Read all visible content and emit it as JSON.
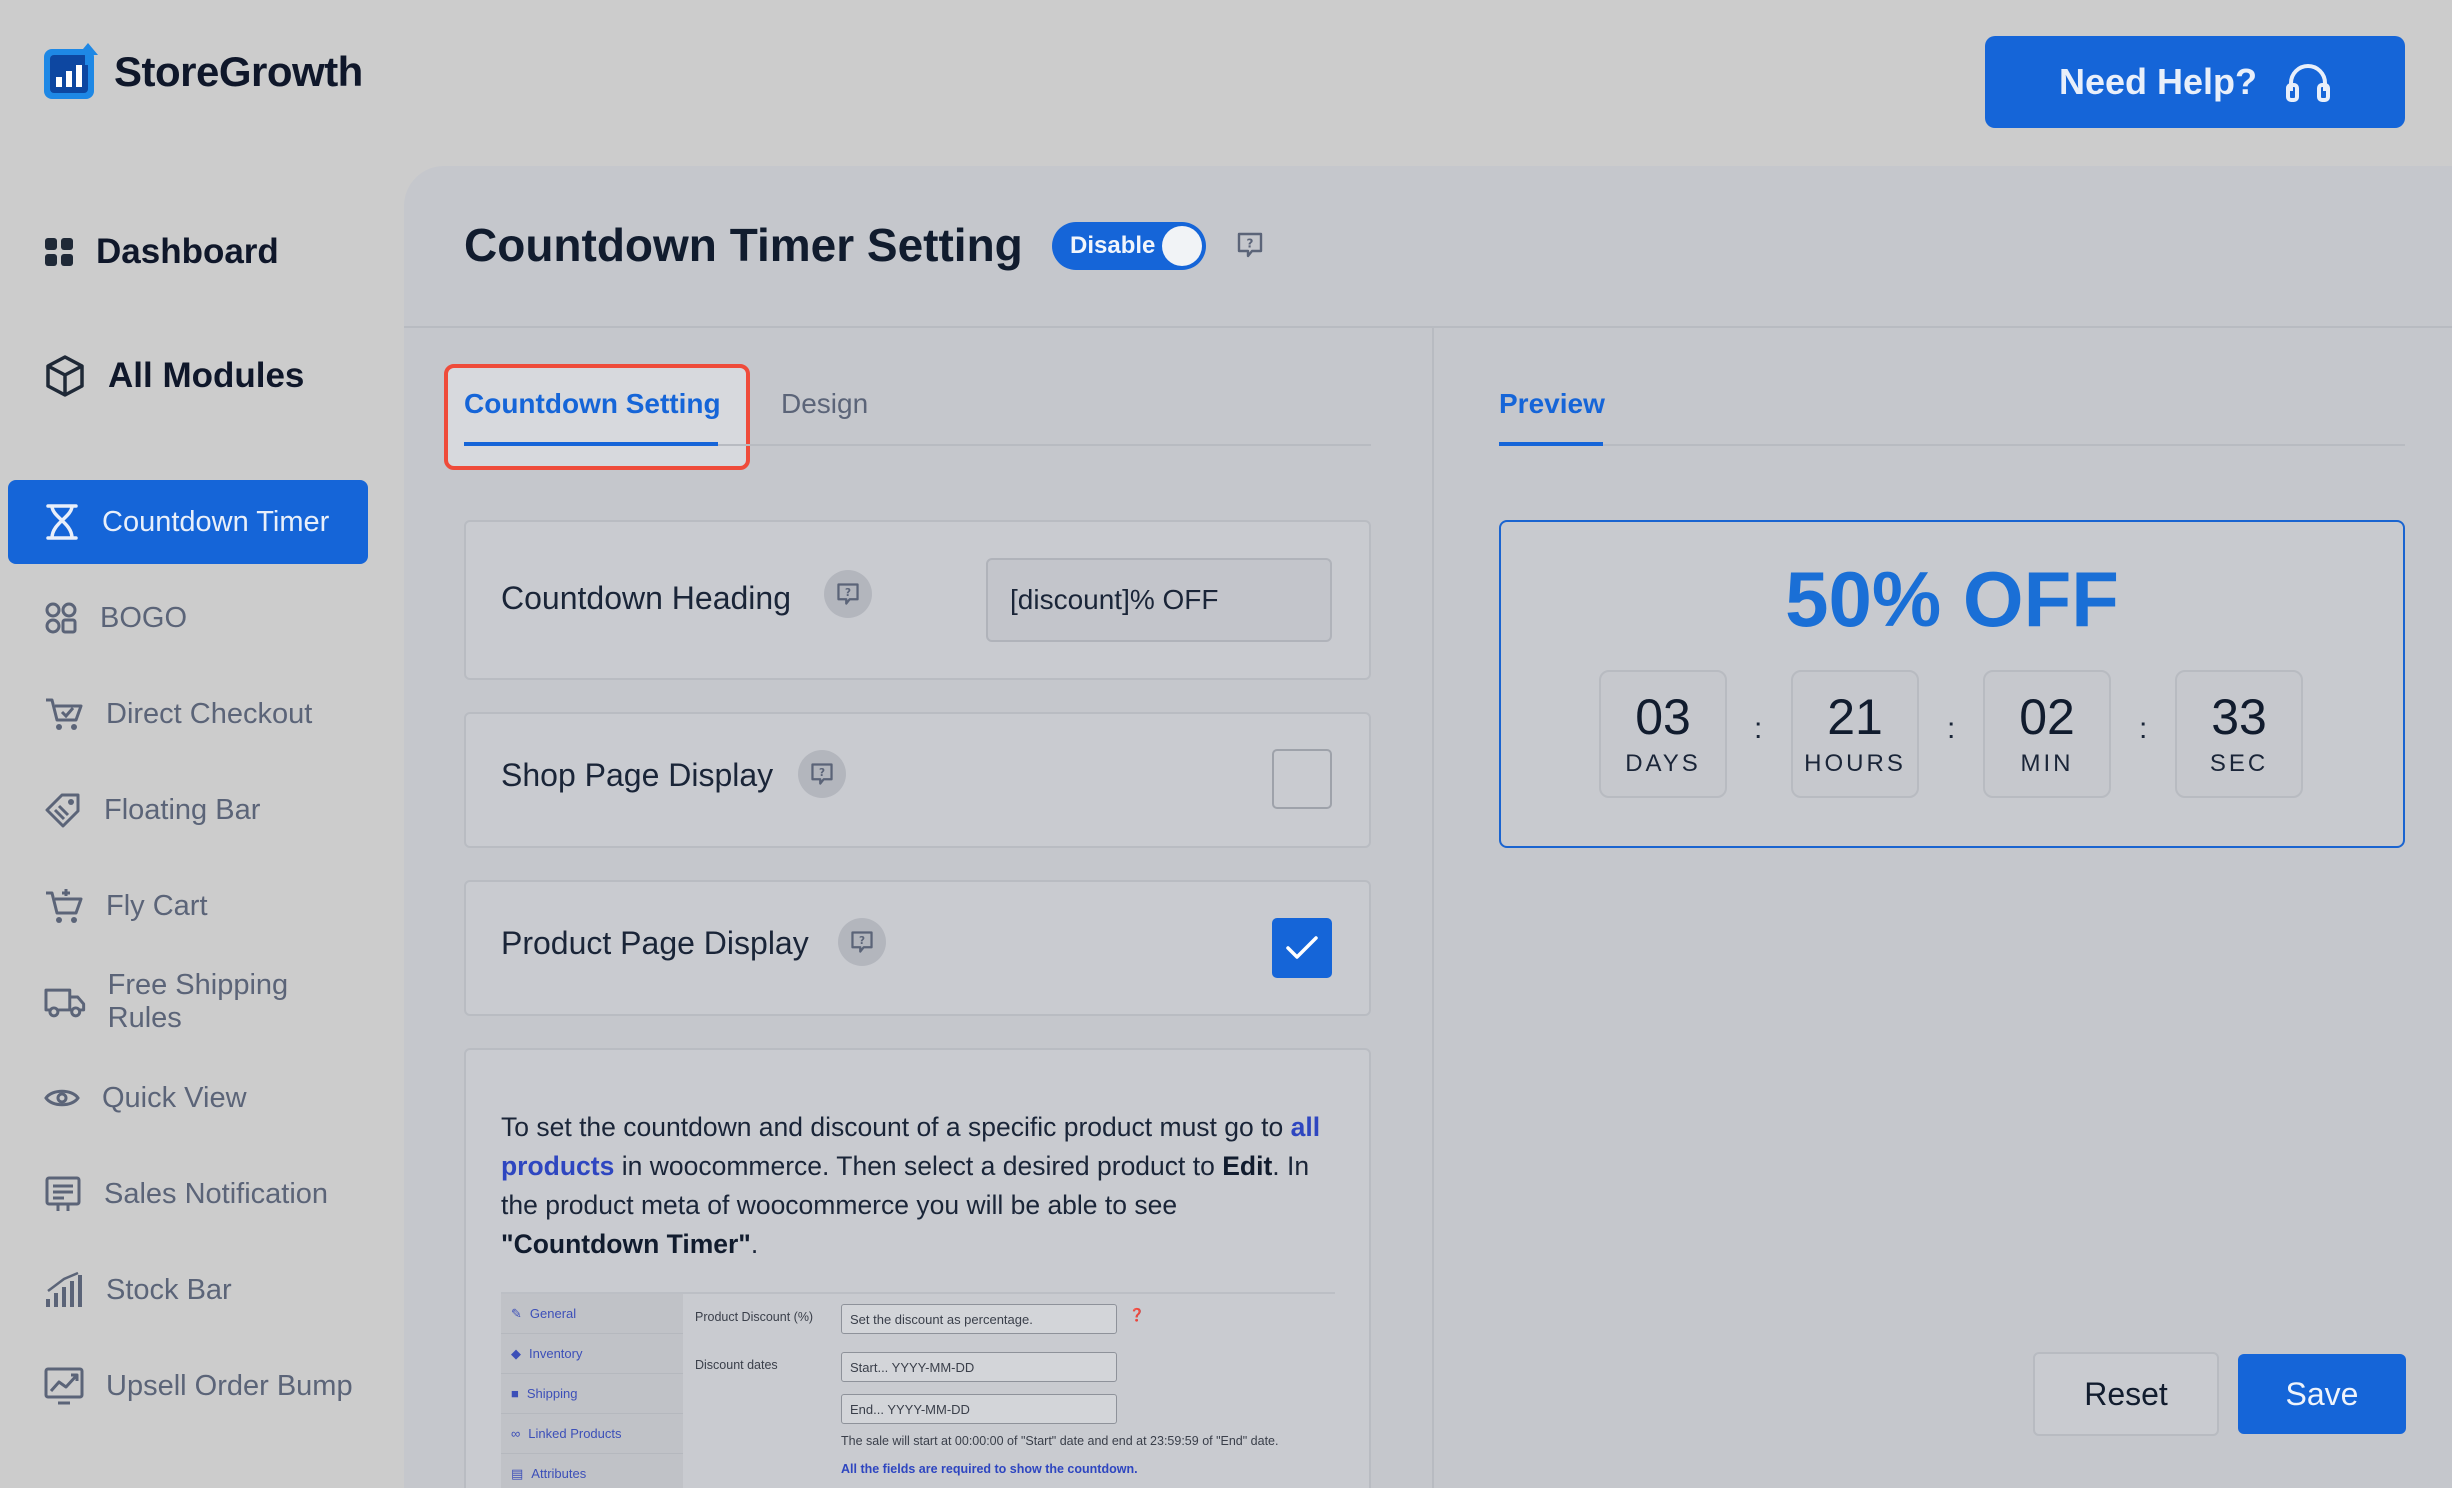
{
  "brand": {
    "name": "StoreGrowth"
  },
  "header": {
    "help_label": "Need Help?"
  },
  "sidebar": {
    "top_items": [
      {
        "label": "Dashboard",
        "icon": "dashboard-icon"
      },
      {
        "label": "All Modules",
        "icon": "cube-icon"
      }
    ],
    "modules": [
      {
        "label": "Countdown Timer",
        "icon": "hourglass-icon",
        "active": true
      },
      {
        "label": "BOGO",
        "icon": "bogo-icon"
      },
      {
        "label": "Direct Checkout",
        "icon": "cart-icon"
      },
      {
        "label": "Floating Bar",
        "icon": "tag-icon"
      },
      {
        "label": "Fly Cart",
        "icon": "fly-cart-icon"
      },
      {
        "label": "Free Shipping Rules",
        "icon": "truck-icon"
      },
      {
        "label": "Quick View",
        "icon": "eye-icon"
      },
      {
        "label": "Sales Notification",
        "icon": "notification-icon"
      },
      {
        "label": "Stock Bar",
        "icon": "bar-chart-icon"
      },
      {
        "label": "Upsell Order Bump",
        "icon": "trend-chart-icon"
      }
    ]
  },
  "page": {
    "title": "Countdown Timer Setting",
    "toggle_label": "Disable"
  },
  "tabs": [
    {
      "label": "Countdown Setting",
      "active": true
    },
    {
      "label": "Design",
      "active": false
    }
  ],
  "settings": {
    "heading_label": "Countdown Heading",
    "heading_value": "[discount]% OFF",
    "shop_display_label": "Shop Page Display",
    "shop_display_checked": false,
    "product_display_label": "Product Page Display",
    "product_display_checked": true
  },
  "info": {
    "p1": "To set the countdown and discount of a specific product must go to ",
    "link": "all products",
    "p2": " in woocommerce. Then select a desired product to ",
    "edit": "Edit",
    "p3": ". In the product meta of woocommerce you will be able to see ",
    "countdown": "\"Countdown Timer\"",
    "p4": "."
  },
  "thumbnail": {
    "menu": [
      "General",
      "Inventory",
      "Shipping",
      "Linked Products",
      "Attributes"
    ],
    "discount_label": "Product Discount (%)",
    "discount_placeholder": "Set the discount as percentage.",
    "dates_label": "Discount dates",
    "start_placeholder": "Start... YYYY-MM-DD",
    "end_placeholder": "End... YYYY-MM-DD",
    "note": "The sale will start at 00:00:00 of \"Start\" date and end at 23:59:59 of \"End\" date.",
    "required": "All the fields are required to show the countdown."
  },
  "preview": {
    "tab_label": "Preview",
    "discount_text": "50% OFF",
    "units": [
      {
        "value": "03",
        "label": "DAYS"
      },
      {
        "value": "21",
        "label": "HOURS"
      },
      {
        "value": "02",
        "label": "MIN"
      },
      {
        "value": "33",
        "label": "SEC"
      }
    ],
    "separator": ":"
  },
  "actions": {
    "reset_label": "Reset",
    "save_label": "Save"
  },
  "colors": {
    "accent": "#1565d8",
    "highlight": "#ef4b3a",
    "preview_text": "#1a6fd6"
  }
}
